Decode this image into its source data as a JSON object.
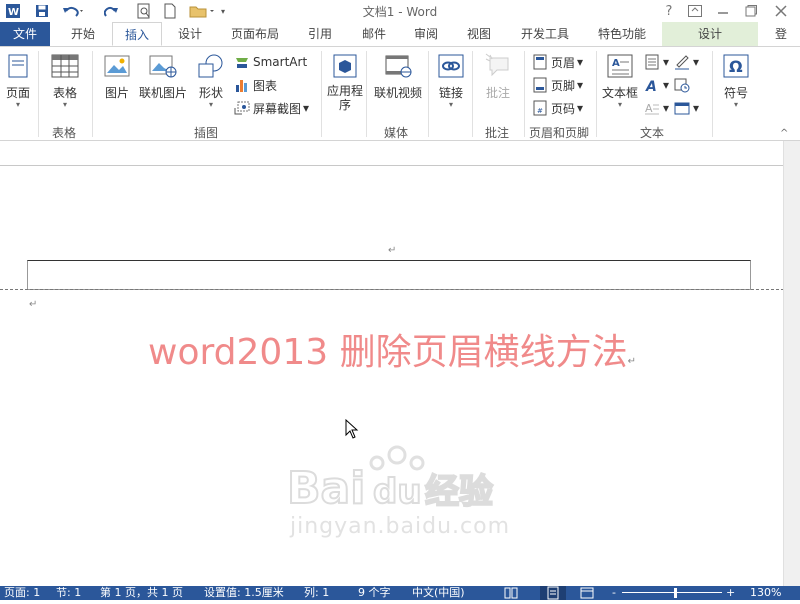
{
  "window": {
    "title": "文档1 - Word",
    "help": "?",
    "controls": [
      "ribbon-display-icon",
      "minimize-icon",
      "restore-icon",
      "close-icon"
    ]
  },
  "quick_access": [
    "word-logo-icon",
    "save-icon",
    "undo-icon",
    "redo-icon",
    "print-preview-icon",
    "new-doc-icon",
    "open-folder-icon",
    "customize-icon"
  ],
  "tabs": {
    "file": "文件",
    "home": "开始",
    "insert": "插入",
    "design": "设计",
    "layout": "页面布局",
    "references": "引用",
    "mailings": "邮件",
    "review": "审阅",
    "view": "视图",
    "developer": "开发工具",
    "special": "特色功能",
    "header_design": "设计",
    "signin": "登"
  },
  "ribbon": {
    "page": "页面",
    "table": "表格",
    "picture": "图片",
    "online_picture": "联机图片",
    "shapes": "形状",
    "smartart": "SmartArt",
    "chart": "图表",
    "screenshot": "屏幕截图",
    "apps": "应用程序",
    "online_video": "联机视频",
    "link": "链接",
    "comment": "批注",
    "header": "页眉",
    "footer": "页脚",
    "page_number": "页码",
    "textbox": "文本框",
    "symbol": "符号",
    "groups": {
      "table": "表格",
      "illustrations": "插图",
      "media": "媒体",
      "comments": "批注",
      "header_footer": "页眉和页脚",
      "text": "文本"
    },
    "accent": "#2b579a"
  },
  "document": {
    "title_text": "word2013 删除页眉横线方法",
    "title_color": "#f08a8a",
    "paragraph_mark": "↵",
    "watermark_url": "jingyan.baidu.com",
    "watermark_logo_text": "Bai du 经验"
  },
  "status": {
    "page": "页面: 1",
    "section": "节: 1",
    "pages": "第 1 页，共 1 页",
    "position": "设置值: 1.5厘米",
    "column": "列: 1",
    "words": "9 个字",
    "language": "中文(中国)",
    "zoom_minus": "-",
    "zoom_plus": "+",
    "zoom": "130%"
  }
}
